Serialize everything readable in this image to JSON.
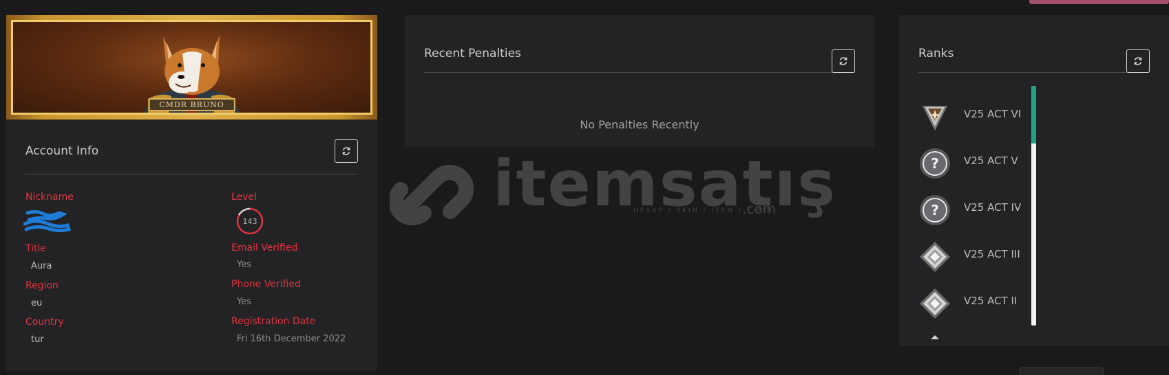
{
  "banner": {
    "plaque_text": "CMDR BRUNO"
  },
  "account": {
    "title": "Account Info",
    "fields": {
      "nickname": {
        "label": "Nickname",
        "value": ""
      },
      "level": {
        "label": "Level",
        "value": "143"
      },
      "title": {
        "label": "Title",
        "value": "Aura"
      },
      "email_verified": {
        "label": "Email Verified",
        "value": "Yes"
      },
      "region": {
        "label": "Region",
        "value": "eu"
      },
      "phone_verified": {
        "label": "Phone Verified",
        "value": "Yes"
      },
      "country": {
        "label": "Country",
        "value": "tur"
      },
      "registration_date": {
        "label": "Registration Date",
        "value": "Fri 16th December 2022"
      }
    }
  },
  "penalties": {
    "title": "Recent Penalties",
    "empty_text": "No Penalties Recently"
  },
  "ranks": {
    "title": "Ranks",
    "items": [
      {
        "label": "V25 ACT VI",
        "icon": "rank-ascendant-icon"
      },
      {
        "label": "V25 ACT V",
        "icon": "unknown-rank-icon"
      },
      {
        "label": "V25 ACT IV",
        "icon": "unknown-rank-icon"
      },
      {
        "label": "V25 ACT III",
        "icon": "rank-diamond-icon"
      },
      {
        "label": "V25 ACT II",
        "icon": "rank-diamond-icon"
      }
    ]
  },
  "watermark": {
    "brand": "itemsatış",
    "tagline": "HESAP / SKIN / ITEM / E-PIN",
    "suffix": ".com"
  },
  "colors": {
    "background": "#1a191b",
    "card": "#232224",
    "accent_red": "#e0353f",
    "scroll_thumb": "#21a388",
    "top_accent": "#a2506e"
  }
}
